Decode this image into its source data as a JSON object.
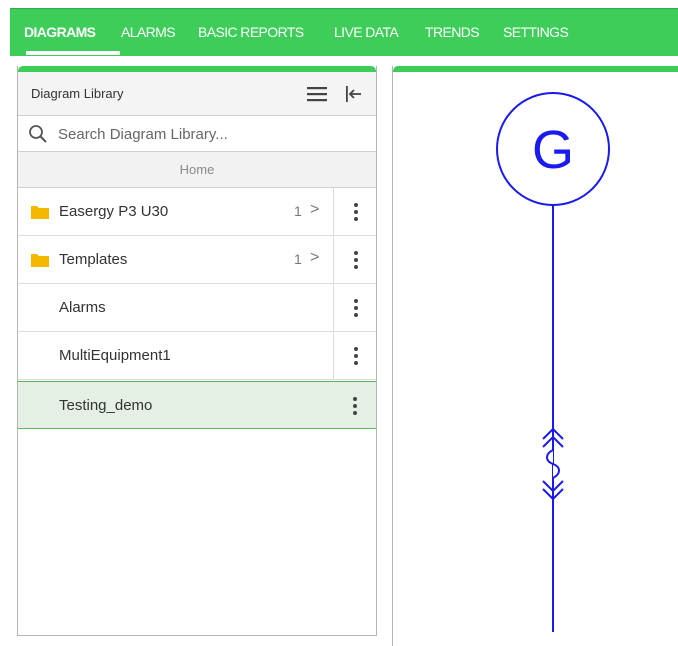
{
  "nav": {
    "tabs": [
      {
        "label": "DIAGRAMS",
        "active": true
      },
      {
        "label": "ALARMS"
      },
      {
        "label": "BASIC REPORTS"
      },
      {
        "label": "LIVE DATA"
      },
      {
        "label": "TRENDS"
      },
      {
        "label": "SETTINGS"
      }
    ]
  },
  "library": {
    "title": "Diagram Library",
    "search_placeholder": "Search Diagram Library...",
    "home_label": "Home",
    "items": [
      {
        "label": "Easergy P3 U30",
        "type": "folder",
        "count": "1",
        "chevron": ">"
      },
      {
        "label": "Templates",
        "type": "folder",
        "count": "1",
        "chevron": ">"
      },
      {
        "label": "Alarms",
        "type": "diagram"
      },
      {
        "label": "MultiEquipment1",
        "type": "diagram"
      },
      {
        "label": "Testing_demo",
        "type": "diagram",
        "selected": true
      }
    ]
  },
  "diagram": {
    "generator_label": "G"
  },
  "colors": {
    "brand_green": "#3dcd58",
    "diagram_line": "#1a1aee",
    "folder": "#f5b800",
    "selected_row": "#e5f0e5"
  },
  "icons": [
    "menu-icon",
    "collapse-left-icon",
    "search-icon",
    "folder-icon",
    "kebab-icon",
    "generator-symbol"
  ]
}
